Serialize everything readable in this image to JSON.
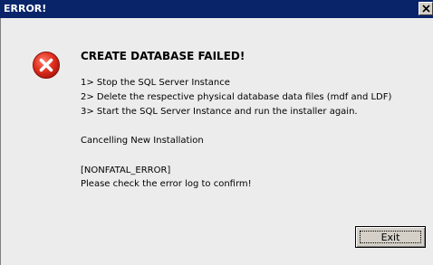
{
  "window": {
    "title": "ERROR!",
    "close_label": "×"
  },
  "message": {
    "heading": "CREATE DATABASE FAILED!",
    "steps": [
      "1> Stop the SQL Server Instance",
      "2> Delete the respective physical database data files (mdf and LDF)",
      "3> Start the SQL Server Instance and run the installer again."
    ],
    "status": "Cancelling New Installation",
    "error_code": "[NONFATAL_ERROR]",
    "instruction": "Please check the error log to confirm!"
  },
  "icons": {
    "error": "error-icon",
    "close": "close-icon"
  },
  "colors": {
    "titlebar": "#0a246a",
    "error_red": "#d9261c",
    "dialog_bg": "#ececec"
  },
  "buttons": {
    "exit_label": "Exit"
  }
}
